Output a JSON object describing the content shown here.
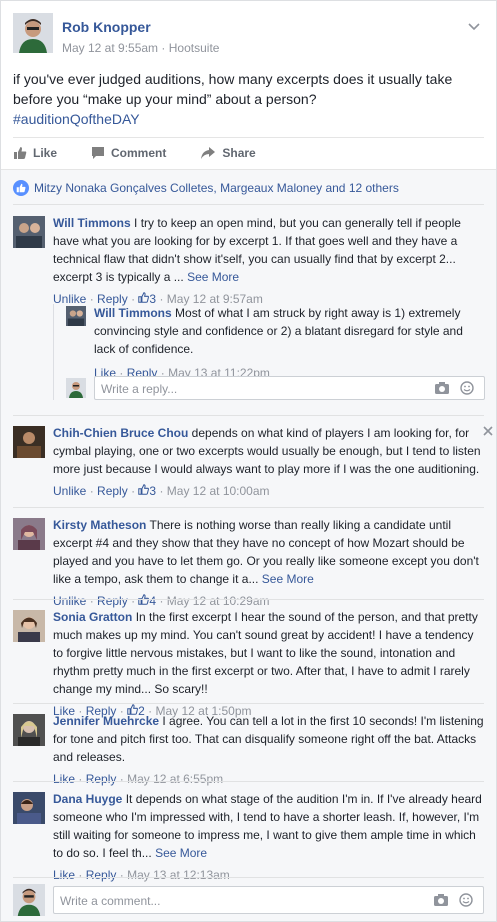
{
  "post": {
    "author": "Rob Knopper",
    "date": "May 12 at 9:55am",
    "via": "Hootsuite",
    "text": "if you've ever judged auditions, how many excerpts does it usually take before you “make up your mind” about a person?",
    "hashtag": "#auditionQoftheDAY"
  },
  "actions": {
    "like": "Like",
    "comment": "Comment",
    "share": "Share"
  },
  "likers": "Mitzy Nonaka Gonçalves Colletes, Margeaux Maloney and 12 others",
  "comments": [
    {
      "name": "Will Timmons",
      "text": "I try to keep an open mind, but you can generally tell if people have what you are looking for by excerpt 1. If that goes well and they have a technical flaw that didn't show it'self, you can usually find that by excerpt 2... excerpt 3 is typically a ...",
      "see_more": "See More",
      "unlike": "Unlike",
      "reply": "Reply",
      "likes": "3",
      "date": "May 12 at 9:57am",
      "reply_item": {
        "name": "Will Timmons",
        "text": "Most of what I am struck by right away is 1) extremely convincing style and confidence or 2) a blatant disregard for style and lack of confidence.",
        "like": "Like",
        "reply": "Reply",
        "date": "May 13 at 11:22pm"
      },
      "reply_placeholder": "Write a reply..."
    },
    {
      "name": "Chih-Chien Bruce Chou",
      "text": "depends on what kind of players I am looking for, for cymbal playing, one or two excerpts would usually be enough, but I tend to listen more just because I would always want to play more if I was the one auditioning.",
      "unlike": "Unlike",
      "reply": "Reply",
      "likes": "3",
      "date": "May 12 at 10:00am"
    },
    {
      "name": "Kirsty Matheson",
      "text": "There is nothing worse than really liking a candidate until excerpt #4 and they show that they have no concept of how Mozart should be played and you have to let them go. Or you really like someone except you don't like a tempo, ask them to change it a...",
      "see_more": "See More",
      "unlike": "Unlike",
      "reply": "Reply",
      "likes": "4",
      "date": "May 12 at 10:29am"
    },
    {
      "name": "Sonia Gratton",
      "text": "In the first excerpt I hear the sound of the person, and that pretty much makes up my mind. You can't sound great by accident! I have a tendency to forgive little nervous mistakes, but I want to like the sound, intonation and rhythm pretty much in the first excerpt or two. After that, I have to admit I rarely change my mind... So scary!!",
      "like": "Like",
      "reply": "Reply",
      "likes": "2",
      "date": "May 12 at 1:50pm"
    },
    {
      "name": "Jennifer Muehrcke",
      "text": "I agree. You can tell a lot in the first 10 seconds! I'm listening for tone and pitch first too. That can disqualify someone right off the bat. Attacks and releases.",
      "like": "Like",
      "reply": "Reply",
      "date": "May 12 at 6:55pm"
    },
    {
      "name": "Dana Huyge",
      "text": "It depends on what stage of the audition I'm in. If I've already heard someone who I'm impressed with, I tend to have a shorter leash. If, however, I'm still waiting for someone to impress me, I want to give them ample time in which to do so. I feel th...",
      "see_more": "See More",
      "like": "Like",
      "reply": "Reply",
      "date": "May 13 at 12:13am"
    }
  ],
  "comment_placeholder": "Write a comment...",
  "colors": {
    "link": "#365899",
    "muted": "#90949c",
    "like_blue": "#5890ff",
    "background": "#f6f7f9"
  }
}
